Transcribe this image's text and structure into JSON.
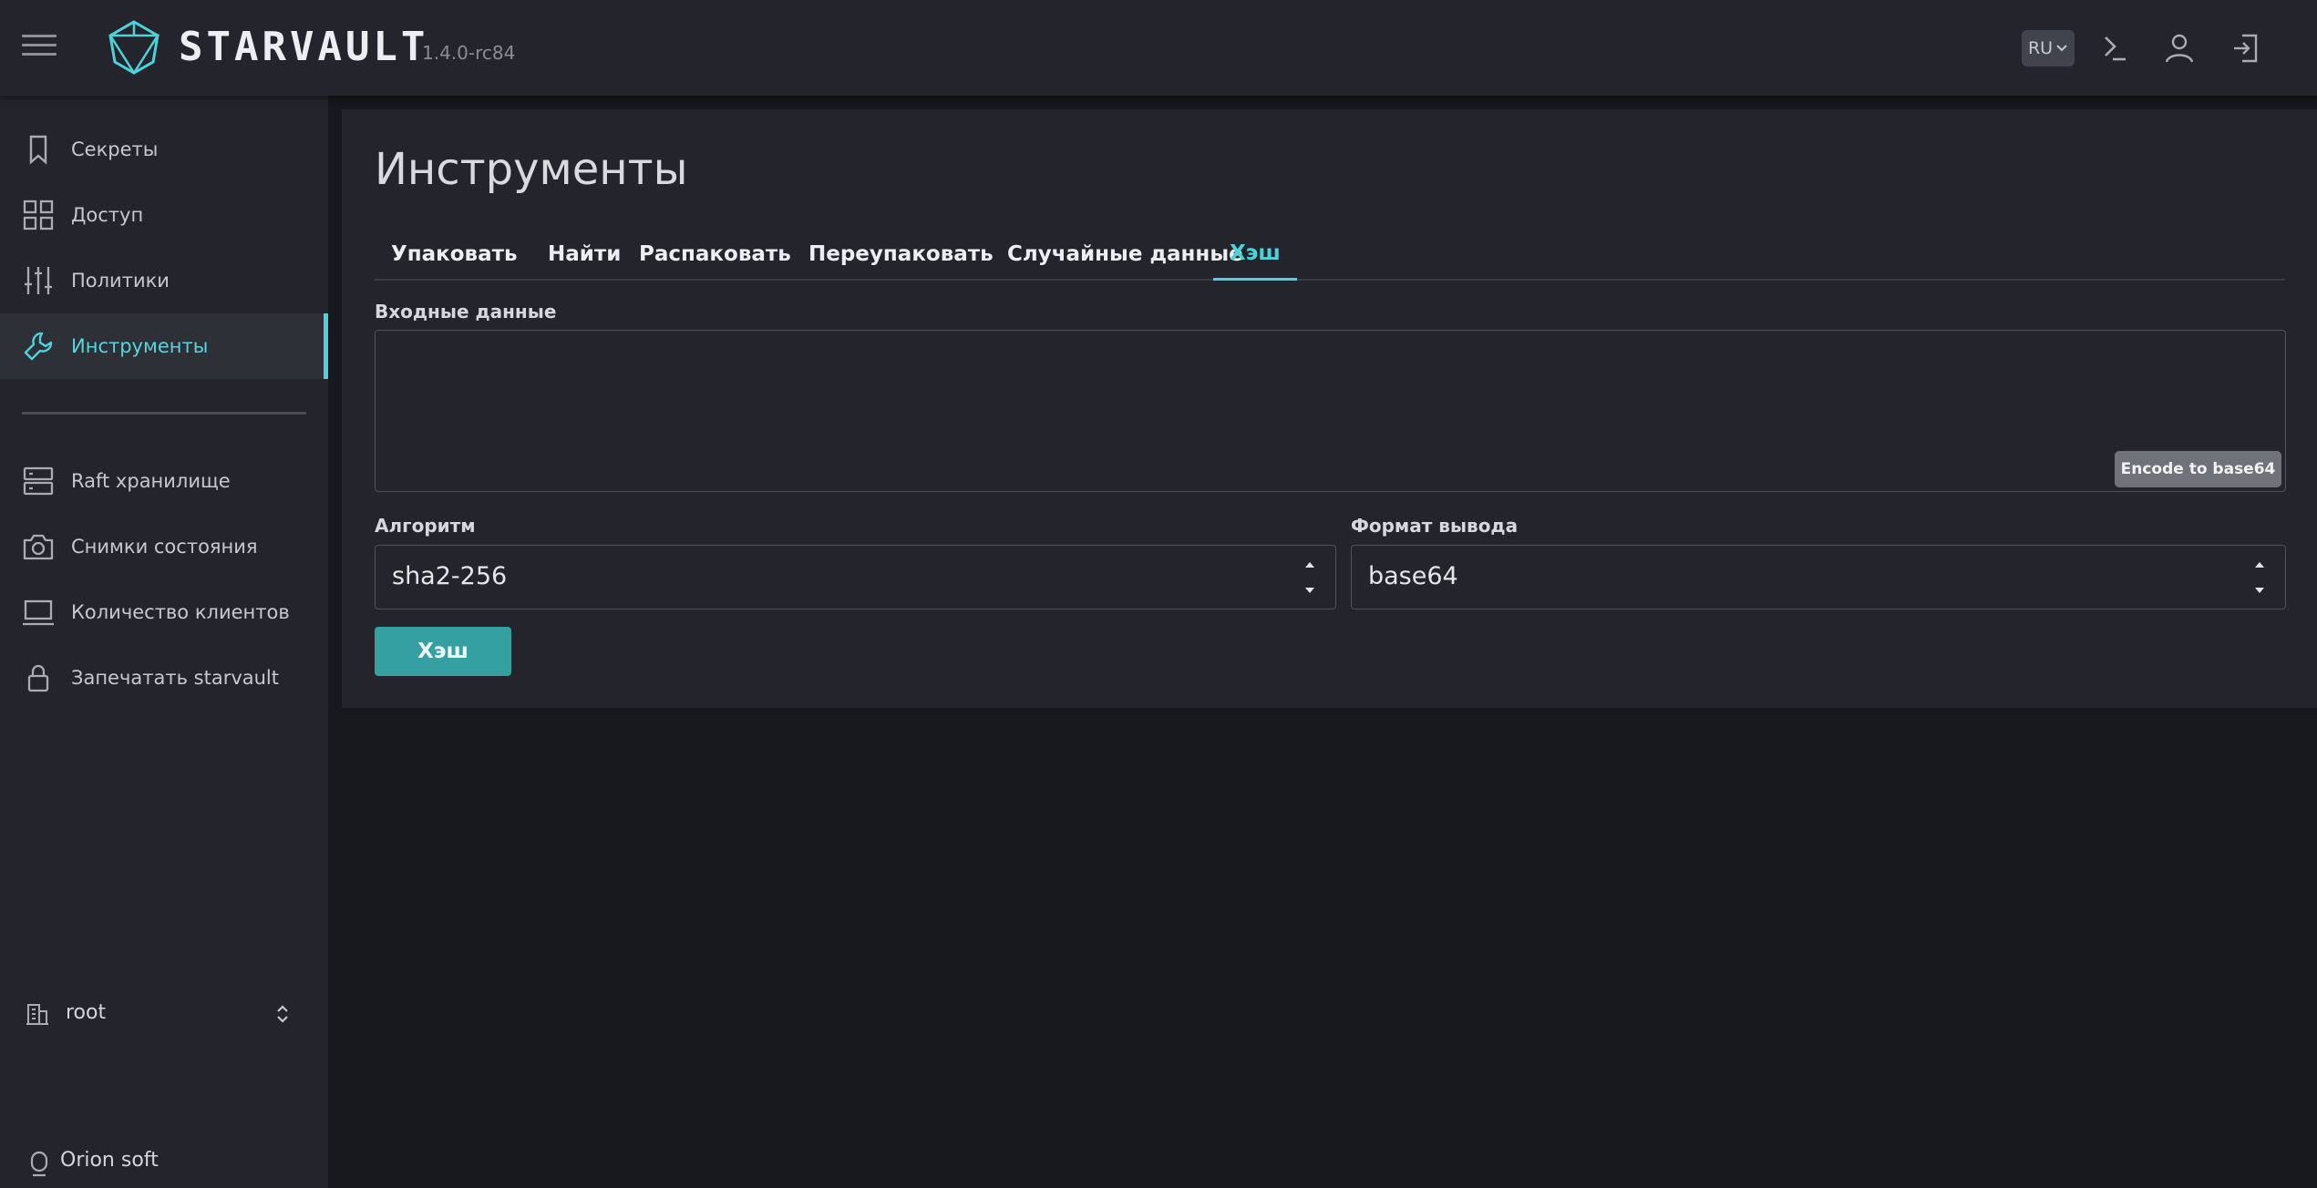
{
  "app": {
    "name": "STARVAULT",
    "version": "1.4.0-rc84"
  },
  "topbar": {
    "language": "RU"
  },
  "sidebar": {
    "items": [
      {
        "label": "Секреты",
        "icon": "bookmark-icon"
      },
      {
        "label": "Доступ",
        "icon": "grid-icon"
      },
      {
        "label": "Политики",
        "icon": "sliders-icon"
      },
      {
        "label": "Инструменты",
        "icon": "wrench-icon",
        "active": true
      },
      {
        "label": "Raft хранилище",
        "icon": "server-icon"
      },
      {
        "label": "Снимки состояния",
        "icon": "camera-icon"
      },
      {
        "label": "Количество клиентов",
        "icon": "laptop-icon"
      },
      {
        "label": "Запечатать starvault",
        "icon": "lock-icon"
      }
    ],
    "namespace": "root",
    "organization": "Orion soft"
  },
  "main": {
    "title": "Инструменты",
    "tabs": [
      {
        "label": "Упаковать"
      },
      {
        "label": "Найти"
      },
      {
        "label": "Распаковать"
      },
      {
        "label": "Переупаковать"
      },
      {
        "label": "Случайные данные"
      },
      {
        "label": "Хэш",
        "active": true
      }
    ],
    "input_label": "Входные данные",
    "input_value": "",
    "encode_button": "Encode to base64",
    "algorithm_label": "Алгоритм",
    "algorithm_value": "sha2-256",
    "format_label": "Формат вывода",
    "format_value": "base64",
    "submit_button": "Хэш"
  },
  "colors": {
    "accent": "#4fd1d9",
    "button": "#34a0a2",
    "panel": "#24252c",
    "background": "#17181d"
  }
}
